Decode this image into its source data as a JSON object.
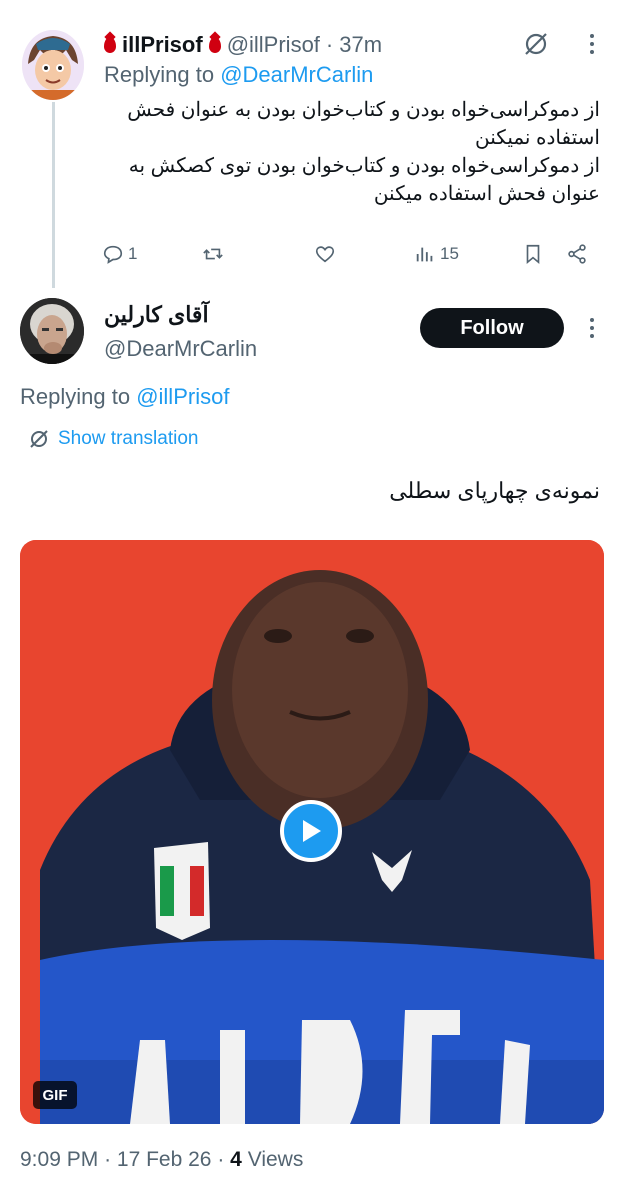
{
  "tweet1": {
    "display_name": "illPrisof",
    "handle": "@illPrisof",
    "separator": "·",
    "time": "37m",
    "replying_prefix": "Replying to",
    "replying_to": "@DearMrCarlin",
    "lines": [
      "از دموکراسی‌خواه بودن و کتاب‌خوان بودن به عنوان فحش",
      "استفاده نمیکنن",
      "از دموکراسی‌خواه بودن و کتاب‌خوان بودن توی کصکش به",
      "عنوان فحش استفاده میکنن"
    ],
    "reply_count": "1",
    "views_count": "15",
    "icons": [
      "grok-icon",
      "more-icon",
      "reply-icon",
      "retweet-icon",
      "like-icon",
      "views-icon",
      "bookmark-icon",
      "share-icon",
      "blood-drop-icon"
    ]
  },
  "tweet2": {
    "display_name": "آقای کارلین",
    "handle": "@DearMrCarlin",
    "follow_label": "Follow",
    "replying_prefix": "Replying to",
    "replying_to": "@illPrisof",
    "translate_label": "Show translation",
    "text": "نمونه‌ی چهارپای سطلی",
    "media_badge": "GIF",
    "time": "9:09 PM",
    "sep1": "·",
    "date": "17 Feb 26",
    "sep2": "·",
    "views_number": "4",
    "views_label": "Views"
  },
  "colors": {
    "accent": "#1d9bf0",
    "muted": "#536471",
    "text": "#0f1419",
    "media_background": "#e8452f",
    "blood_drop": "#d00010"
  }
}
